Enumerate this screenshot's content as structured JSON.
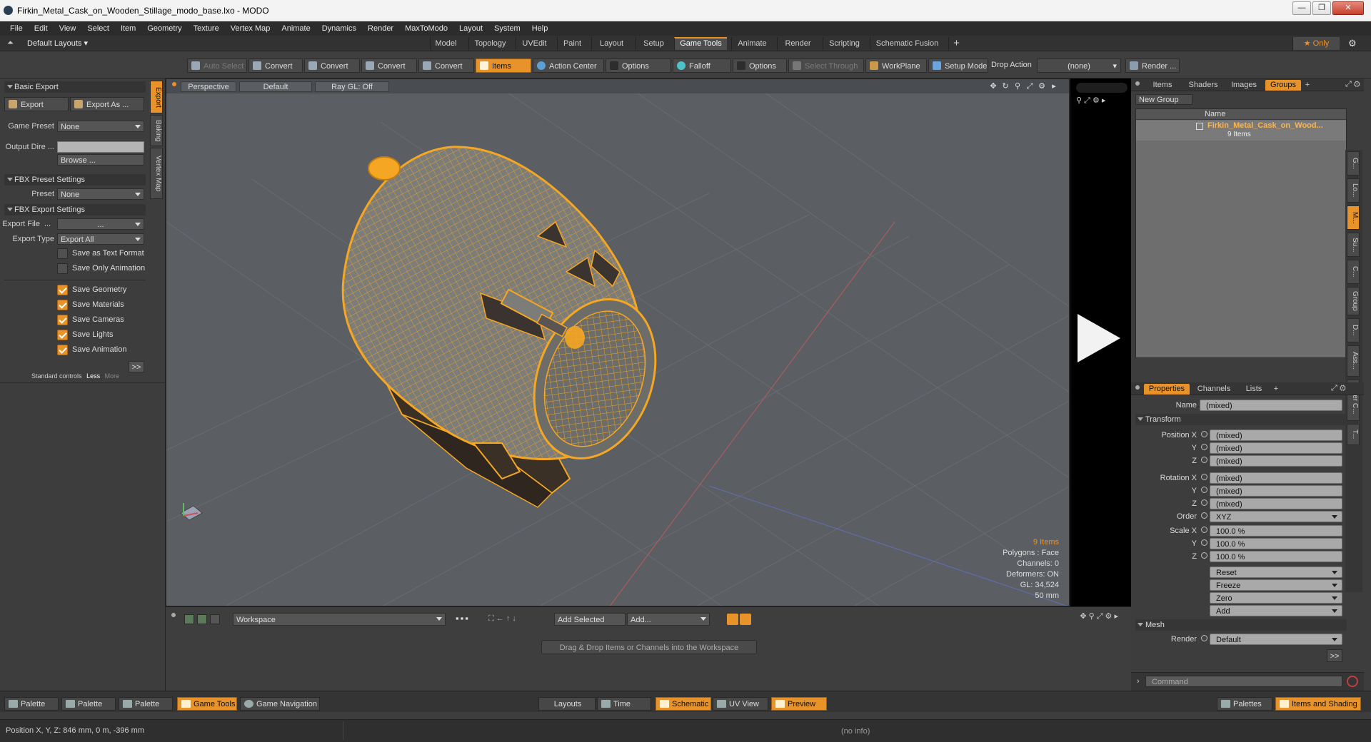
{
  "window": {
    "title": "Firkin_Metal_Cask_on_Wooden_Stillage_modo_base.lxo - MODO",
    "minimize": "—",
    "maximize": "❐",
    "close": "✕"
  },
  "menu": [
    "File",
    "Edit",
    "View",
    "Select",
    "Item",
    "Geometry",
    "Texture",
    "Vertex Map",
    "Animate",
    "Dynamics",
    "Render",
    "MaxToModo",
    "Layout",
    "System",
    "Help"
  ],
  "layouts": {
    "default": "Default Layouts ▾",
    "tabs": [
      "Model",
      "Topology",
      "UVEdit",
      "Paint",
      "Layout",
      "Setup",
      "Game Tools",
      "Animate",
      "Render",
      "Scripting",
      "Schematic Fusion"
    ],
    "active_tab": "Game Tools",
    "add": "+",
    "only": "★  Only"
  },
  "toolbar": {
    "auto_select": "Auto Select",
    "convert": "Convert",
    "items": "Items",
    "action_center": "Action Center",
    "options": "Options",
    "falloff": "Falloff",
    "select_through": "Select Through",
    "workplane": "WorkPlane",
    "setup_mode": "Setup Mode",
    "drop_action": "Drop Action",
    "drop_value": "(none)",
    "render": "Render ..."
  },
  "left": {
    "vtabs": [
      "Export",
      "Baking",
      "Vertex Map"
    ],
    "basic_export": "Basic Export",
    "export_btn": "Export",
    "export_as_btn": "Export As ...",
    "game_preset_label": "Game Preset",
    "game_preset_value": "None",
    "output_dir_label": "Output Dire ...",
    "browse": "Browse ...",
    "fbx_preset": "FBX Preset Settings",
    "preset_label": "Preset",
    "preset_value": "None",
    "fbx_export": "FBX Export Settings",
    "export_file_label": "Export File",
    "export_file_dots": "...",
    "export_file_value": "...",
    "export_type_label": "Export Type",
    "export_type_value": "Export All",
    "save_text": "Save as Text Format",
    "save_anim_only": "Save Only Animation",
    "save_geometry": "Save Geometry",
    "save_materials": "Save Materials",
    "save_cameras": "Save Cameras",
    "save_lights": "Save Lights",
    "save_animation": "Save Animation",
    "more_btn": ">>",
    "standard_controls": "Standard controls",
    "less": "Less",
    "more": "More"
  },
  "viewport": {
    "perspective": "Perspective",
    "default": "Default",
    "raygl": "Ray GL: Off",
    "stats": {
      "items": "9 Items",
      "polygons": "Polygons : Face",
      "channels": "Channels: 0",
      "deformers": "Deformers: ON",
      "gl": "GL: 34,524",
      "scale": "50 mm"
    }
  },
  "right": {
    "top_tabs": [
      "Items",
      "Shaders",
      "Images",
      "Groups"
    ],
    "active_top": "Groups",
    "new_group": "New Group",
    "name_col": "Name",
    "group_name": "Firkin_Metal_Cask_on_Wood...",
    "group_count": "9 Items",
    "prop_tabs": [
      "Properties",
      "Channels",
      "Lists"
    ],
    "name_label": "Name",
    "name_value": "(mixed)",
    "transform": "Transform",
    "position_x": "Position X",
    "rotation_x": "Rotation X",
    "y": "Y",
    "z": "Z",
    "mixed": "(mixed)",
    "order_label": "Order",
    "order_value": "XYZ",
    "scale_x": "Scale X",
    "scale_value": "100.0 %",
    "reset": "Reset",
    "freeze": "Freeze",
    "zero": "Zero",
    "add": "Add",
    "mesh": "Mesh",
    "render_label": "Render",
    "render_value": "Default",
    "more": ">>",
    "command": "Command",
    "side_tabs": [
      "G...",
      "Lo...",
      "M...",
      "Su...",
      "C...",
      "Group",
      "D...",
      "Ass...",
      "User C...",
      "T..."
    ]
  },
  "workspace": {
    "name": "Workspace",
    "add_selected": "Add Selected",
    "add": "Add...",
    "hint": "Drag & Drop Items or Channels into the Workspace"
  },
  "bottom": {
    "palette": "Palette",
    "game_tools": "Game Tools",
    "game_navigation": "Game Navigation",
    "layouts": "Layouts",
    "time": "Time",
    "schematic": "Schematic",
    "uv_view": "UV View",
    "preview": "Preview",
    "palettes": "Palettes",
    "items_shading": "Items and Shading"
  },
  "info": {
    "position": "Position X, Y, Z:  846 mm, 0 m, -396 mm",
    "noinfo": "(no info)"
  },
  "colors": {
    "accent": "#e8922a",
    "wire": "#f5a623",
    "viewport_bg": "#5b5f64"
  }
}
